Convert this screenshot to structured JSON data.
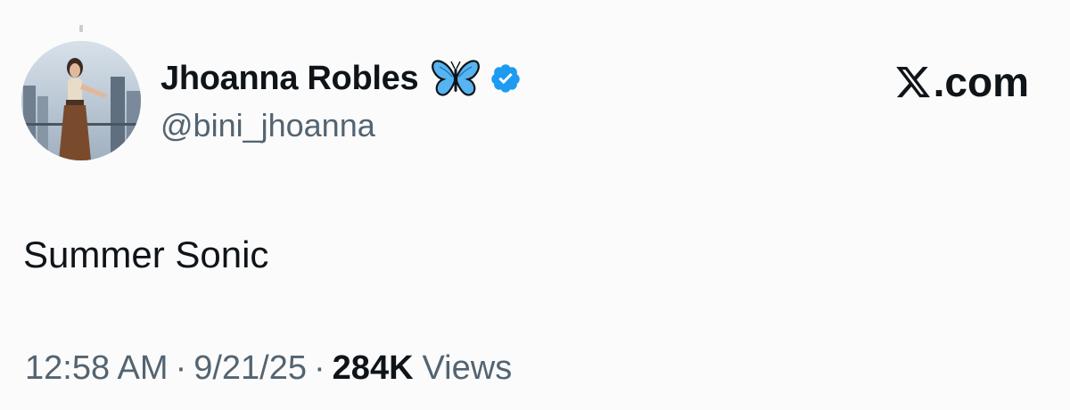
{
  "user": {
    "display_name": "Jhoanna Robles",
    "handle": "@bini_jhoanna",
    "verified": true,
    "name_emoji_icon": "blue-butterfly-icon",
    "avatar_icon": "profile-photo"
  },
  "brand": {
    "logo_icon": "x-logo-icon",
    "suffix": ".com"
  },
  "tweet": {
    "text": "Summer Sonic",
    "time": "12:58 AM",
    "date": "9/21/25",
    "separator": "·",
    "views_count": "284K",
    "views_label": "Views"
  },
  "colors": {
    "background": "#fbfbfc",
    "text_primary": "#0f1419",
    "text_secondary": "#536471",
    "verified_blue": "#1d9bf0"
  }
}
